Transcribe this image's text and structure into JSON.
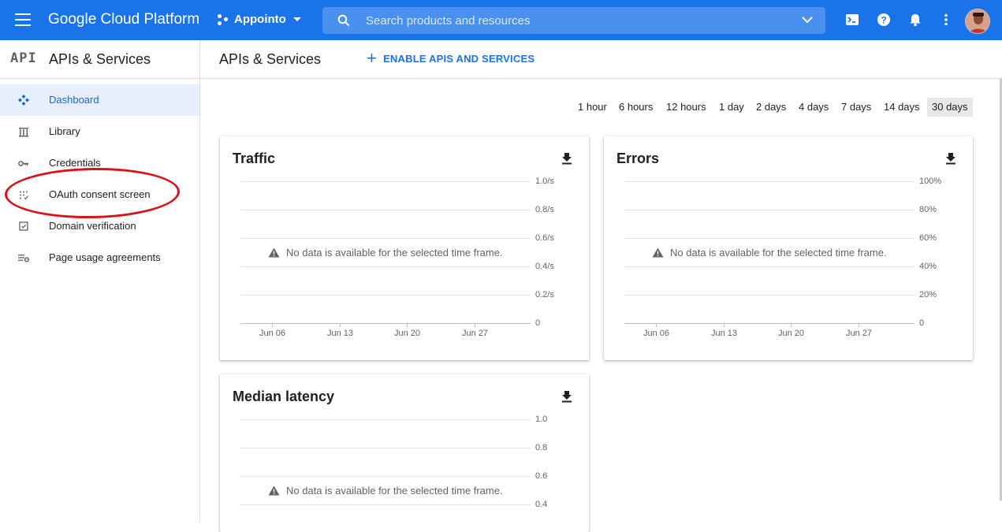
{
  "topbar": {
    "brand": "Google Cloud Platform",
    "project": "Appointo",
    "search_placeholder": "Search products and resources"
  },
  "sidebar": {
    "logo": "API",
    "title": "APIs & Services",
    "items": [
      {
        "label": "Dashboard",
        "icon": "dashboard-icon",
        "active": true
      },
      {
        "label": "Library",
        "icon": "library-icon",
        "active": false
      },
      {
        "label": "Credentials",
        "icon": "key-icon",
        "active": false
      },
      {
        "label": "OAuth consent screen",
        "icon": "consent-grid-icon",
        "active": false
      },
      {
        "label": "Domain verification",
        "icon": "checkbox-icon",
        "active": false
      },
      {
        "label": "Page usage agreements",
        "icon": "settings-list-icon",
        "active": false
      }
    ]
  },
  "main": {
    "title": "APIs & Services",
    "enable_label": "ENABLE APIS AND SERVICES",
    "time_ranges": [
      "1 hour",
      "6 hours",
      "12 hours",
      "1 day",
      "2 days",
      "4 days",
      "7 days",
      "14 days",
      "30 days"
    ],
    "selected_range": "30 days"
  },
  "cards": [
    {
      "title": "Traffic",
      "y_ticks": [
        "1.0/s",
        "0.8/s",
        "0.6/s",
        "0.4/s",
        "0.2/s",
        "0"
      ],
      "x_ticks": [
        "Jun 06",
        "Jun 13",
        "Jun 20",
        "Jun 27"
      ],
      "message": "No data is available for the selected time frame."
    },
    {
      "title": "Errors",
      "y_ticks": [
        "100%",
        "80%",
        "60%",
        "40%",
        "20%",
        "0"
      ],
      "x_ticks": [
        "Jun 06",
        "Jun 13",
        "Jun 20",
        "Jun 27"
      ],
      "message": "No data is available for the selected time frame."
    },
    {
      "title": "Median latency",
      "y_ticks": [
        "1.0",
        "0.8",
        "0.6",
        "0.4"
      ],
      "x_ticks": [],
      "message": "No data is available for the selected time frame."
    }
  ],
  "colors": {
    "topbar": "#1a73e8",
    "accent": "#1a73e8",
    "annotation": "#d8131c"
  }
}
